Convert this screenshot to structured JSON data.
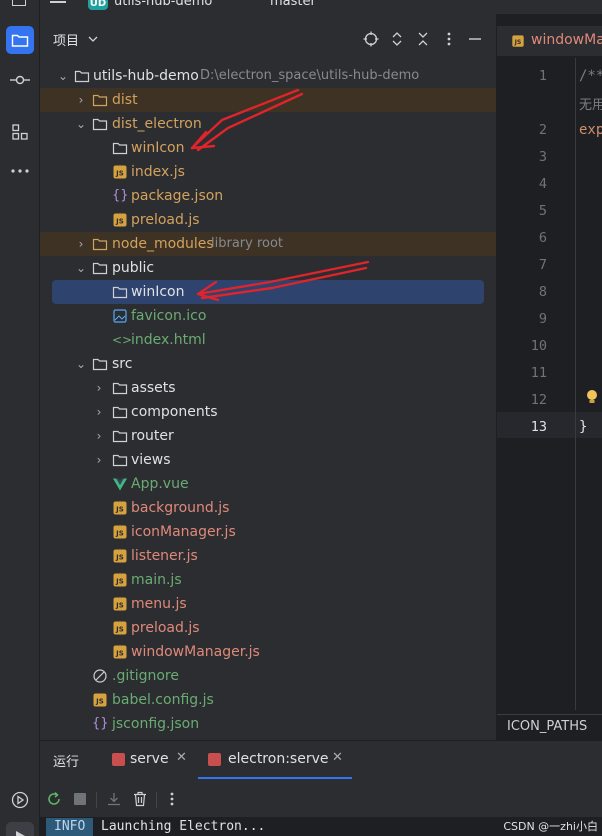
{
  "topbar": {
    "logo": "UD",
    "project": "utils-hub-demo",
    "branch": "master"
  },
  "panel": {
    "title": "项目"
  },
  "tree": {
    "root": {
      "label": "utils-hub-demo",
      "path": "D:\\electron_space\\utils-hub-demo"
    },
    "items": [
      {
        "label": "dist"
      },
      {
        "label": "dist_electron"
      },
      {
        "label": "winIcon"
      },
      {
        "label": "index.js"
      },
      {
        "label": "package.json"
      },
      {
        "label": "preload.js"
      },
      {
        "label": "node_modules",
        "hint": "library root"
      },
      {
        "label": "public"
      },
      {
        "label": "winIcon"
      },
      {
        "label": "favicon.ico"
      },
      {
        "label": "index.html"
      },
      {
        "label": "src"
      },
      {
        "label": "assets"
      },
      {
        "label": "components"
      },
      {
        "label": "router"
      },
      {
        "label": "views"
      },
      {
        "label": "App.vue"
      },
      {
        "label": "background.js"
      },
      {
        "label": "iconManager.js"
      },
      {
        "label": "listener.js"
      },
      {
        "label": "main.js"
      },
      {
        "label": "menu.js"
      },
      {
        "label": "preload.js"
      },
      {
        "label": "windowManager.js"
      },
      {
        "label": ".gitignore"
      },
      {
        "label": "babel.config.js"
      },
      {
        "label": "jsconfig.json"
      }
    ]
  },
  "editor": {
    "tab": "windowMa",
    "lines": [
      "1",
      "2",
      "3",
      "4",
      "5",
      "6",
      "7",
      "8",
      "9",
      "10",
      "11",
      "12",
      "13"
    ],
    "code": {
      "l1": "/**",
      "l1b": "无用",
      "l2": "exp",
      "l13": "}"
    },
    "breadcrumb": "ICON_PATHS"
  },
  "run": {
    "title": "运行",
    "tabs": [
      {
        "label": "serve"
      },
      {
        "label": "electron:serve"
      }
    ],
    "console": {
      "level": "INFO",
      "text": "Launching Electron..."
    }
  },
  "watermark": "CSDN @一zhi小白"
}
